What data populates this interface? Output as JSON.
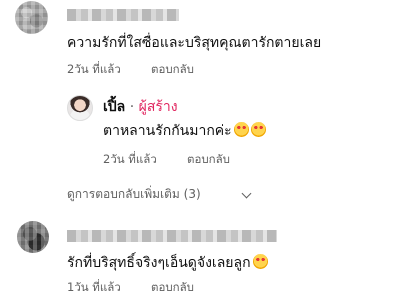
{
  "comments": [
    {
      "text": "ความรักที่ใสซื่อและบริสุทคุณตารักตายเลย",
      "time": "2วัน ที่แล้ว",
      "reply_label": "ตอบกลับ"
    },
    {
      "text": "รักที่บริสุทธิ์จริงๆเอ็นดูจังเลยลูก",
      "time": "1วัน ที่แล้ว",
      "reply_label": "ตอบกลับ"
    }
  ],
  "reply": {
    "author": "เปิ้ล",
    "separator": "·",
    "badge": "ผู้สร้าง",
    "text": "ตาหลานรักกันมากค่ะ",
    "time": "2วัน ที่แล้ว",
    "reply_label": "ตอบกลับ"
  },
  "more_replies_label": "ดูการตอบกลับเพิ่มเติม (3)",
  "icons": [
    "smiling-face-with-hearts-icon",
    "chevron-down-icon"
  ]
}
